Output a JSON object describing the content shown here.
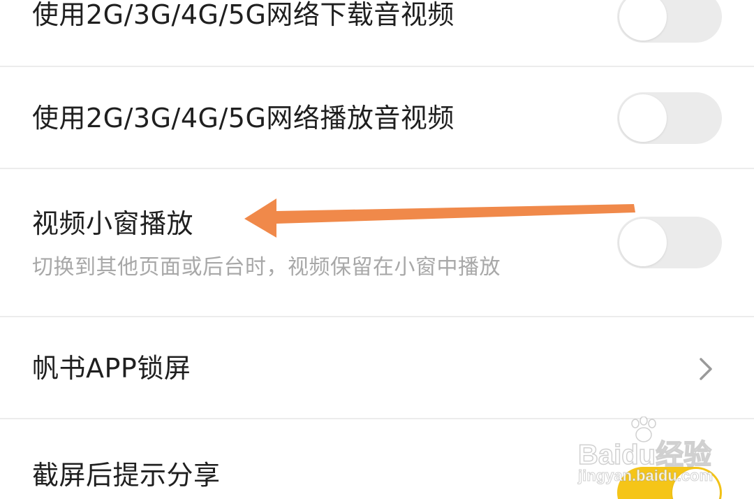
{
  "settings": {
    "download_on_mobile": {
      "label": "使用2G/3G/4G/5G网络下载音视频",
      "enabled": false
    },
    "play_on_mobile": {
      "label": "使用2G/3G/4G/5G网络播放音视频",
      "enabled": false
    },
    "video_pip": {
      "label": "视频小窗播放",
      "description": "切换到其他页面或后台时，视频保留在小窗中播放",
      "enabled": false
    },
    "app_lock": {
      "label": "帆书APP锁屏"
    },
    "screenshot_share": {
      "label": "截屏后提示分享",
      "enabled": true
    }
  },
  "annotation": {
    "arrow_color": "#f0894a"
  },
  "watermark": {
    "brand": "Baidu经验",
    "url": "jingyan.baidu.com"
  },
  "colors": {
    "toggle_off": "#ebebeb",
    "toggle_on": "#f5c518",
    "divider": "#ececec",
    "subtext": "#a8a8a8"
  }
}
